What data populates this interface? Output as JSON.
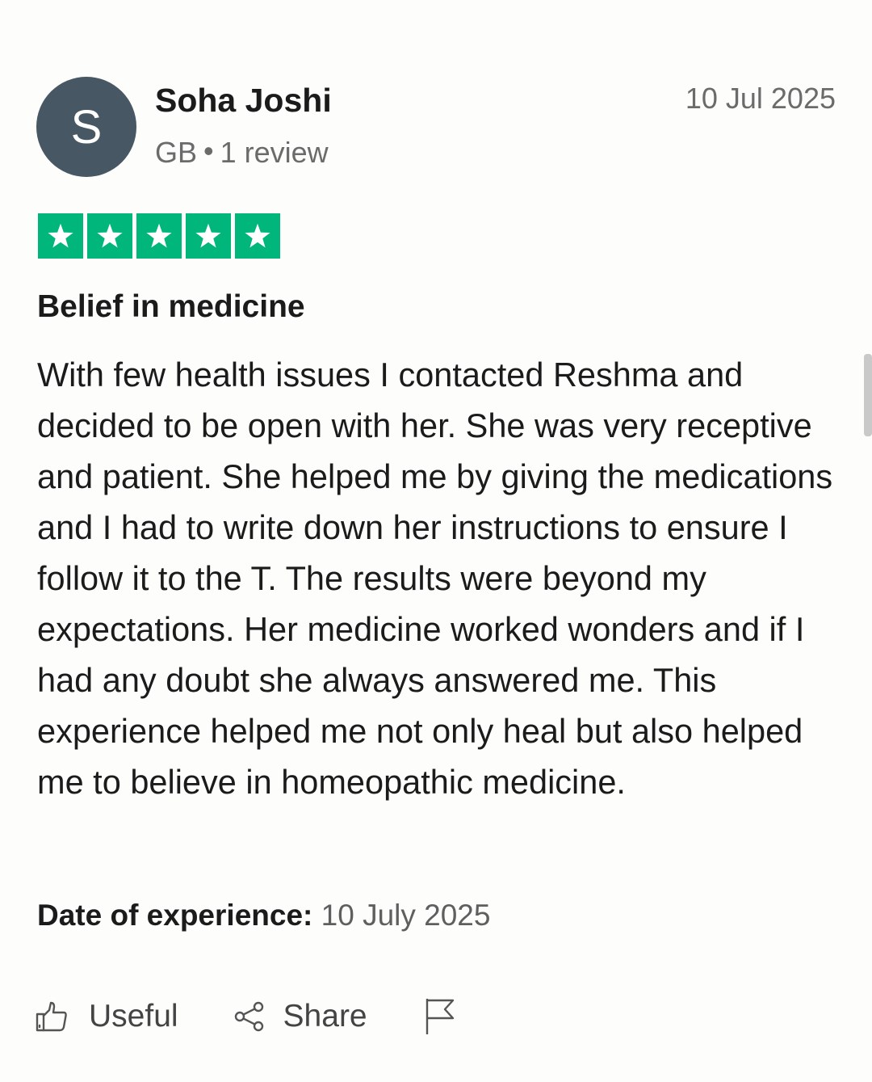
{
  "reviewer": {
    "avatar_initial": "S",
    "name": "Soha Joshi",
    "country": "GB",
    "separator": "•",
    "review_count": "1 review"
  },
  "review": {
    "date": "10 Jul 2025",
    "rating": 5,
    "rating_max": 5,
    "star_color": "#00b67a",
    "title": "Belief in medicine",
    "body": "With few health issues I contacted Reshma and decided to be open with her. She was very receptive and patient. She helped me by giving the medications and I had to write down her instructions to ensure I follow it to the T. The results were beyond my expectations. Her medicine worked wonders and if I had any doubt she always answered me. This experience helped me not only heal but also helped me to believe in homeopathic medicine.",
    "experience_label": "Date of experience:",
    "experience_date": "10 July 2025"
  },
  "actions": {
    "useful_label": "Useful",
    "useful_icon": "thumbs-up-icon",
    "share_label": "Share",
    "share_icon": "share-icon",
    "report_icon": "flag-icon"
  }
}
